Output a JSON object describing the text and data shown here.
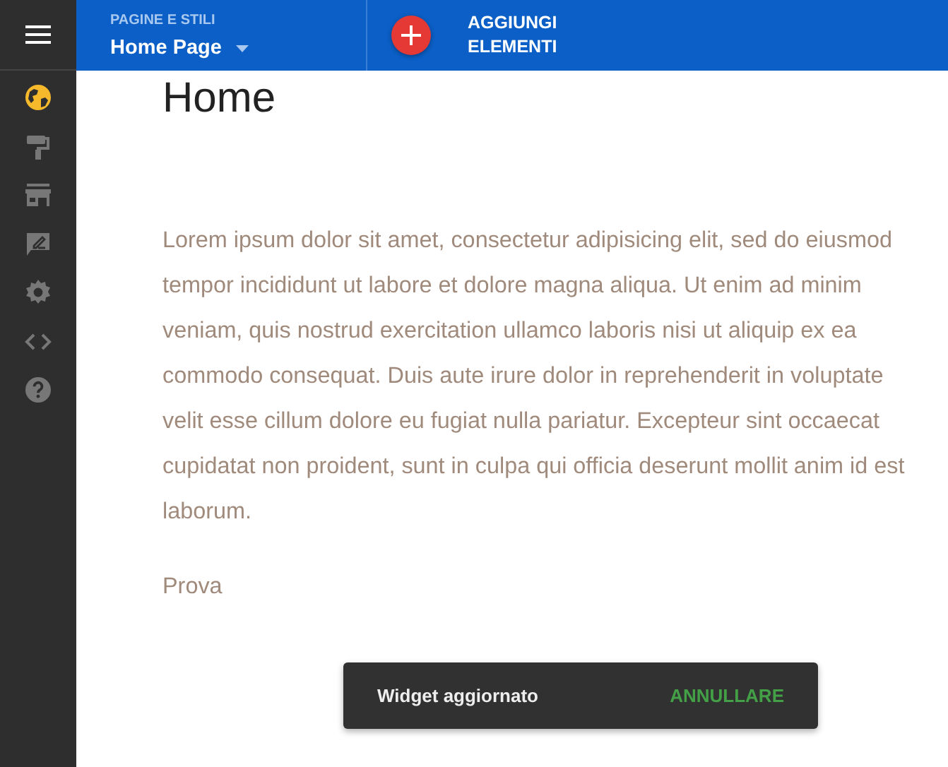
{
  "sidebar": {
    "items": [
      {
        "kind": "globe",
        "selected": true
      },
      {
        "kind": "roller",
        "selected": false
      },
      {
        "kind": "store",
        "selected": false
      },
      {
        "kind": "feedback",
        "selected": false
      },
      {
        "kind": "gear",
        "selected": false
      },
      {
        "kind": "code",
        "selected": false
      },
      {
        "kind": "help",
        "selected": false
      }
    ]
  },
  "topbar": {
    "section_label": "PAGINE E STILI",
    "page_select": "Home Page",
    "add_button": "AGGIUNGI ELEMENTI"
  },
  "content": {
    "heading": "Home",
    "paragraphs": [
      "Lorem ipsum dolor sit amet, consectetur adipisicing elit, sed do eiusmod tempor incididunt ut labore et dolore magna aliqua. Ut enim ad minim veniam, quis nostrud exercitation ullamco laboris nisi ut aliquip ex ea commodo consequat. Duis aute irure dolor in reprehenderit in voluptate velit esse cillum dolore eu fugiat nulla pariatur. Excepteur sint occaecat cupidatat non proident, sunt in culpa qui officia deserunt mollit anim id est laborum.",
      "Prova"
    ]
  },
  "toast": {
    "message": "Widget aggiornato",
    "action": "ANNULLARE"
  }
}
